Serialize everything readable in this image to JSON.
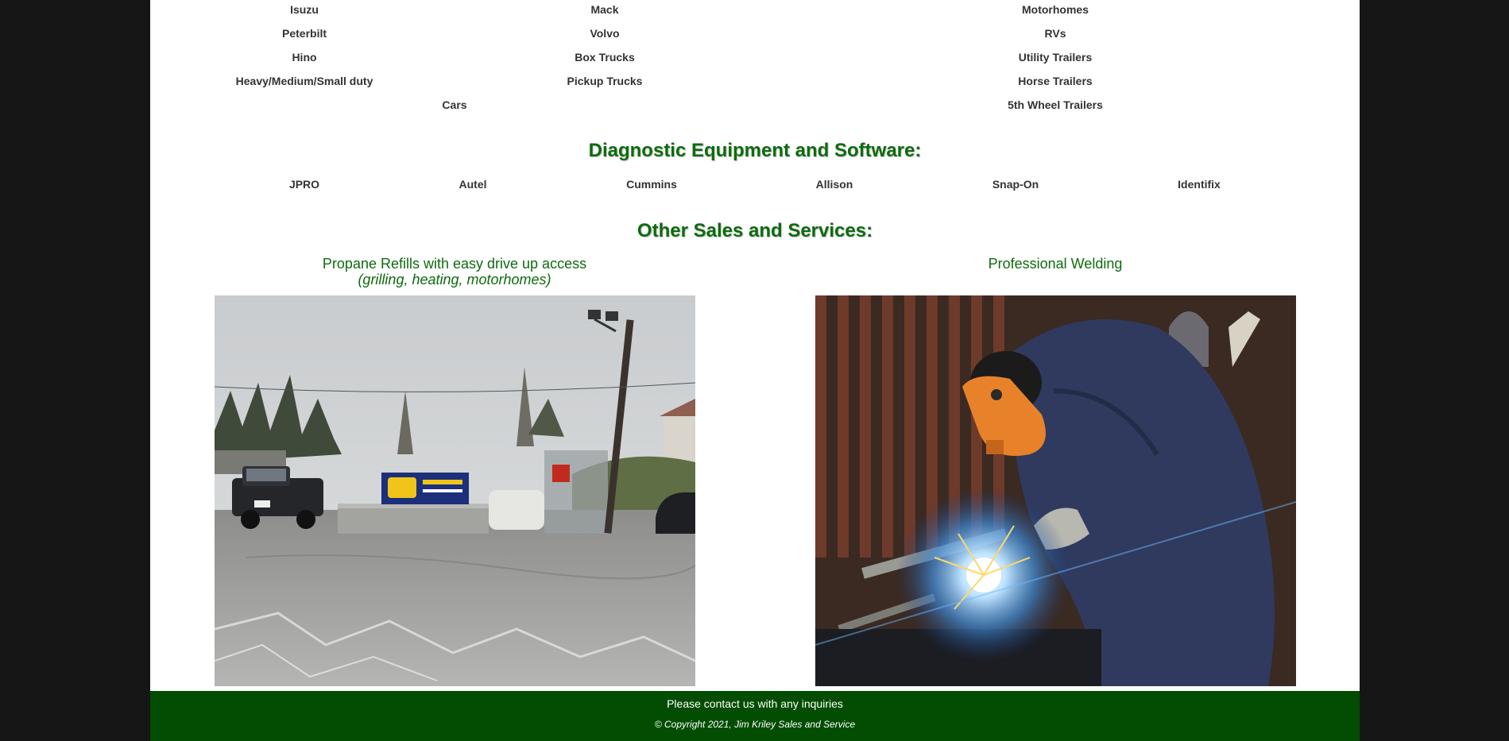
{
  "brands": {
    "row1": [
      "Isuzu",
      "Mack",
      "Motorhomes"
    ],
    "row2": [
      "Peterbilt",
      "Volvo",
      "RVs"
    ],
    "row3": [
      "Hino",
      "Box Trucks",
      "Utility Trailers"
    ],
    "row4": [
      "Heavy/Medium/Small duty",
      "Pickup Trucks",
      "Horse Trailers"
    ],
    "row5": [
      "Cars",
      "5th Wheel Trailers"
    ]
  },
  "diagnostic": {
    "title": "Diagnostic Equipment and Software:",
    "items": [
      "JPRO",
      "Autel",
      "Cummins",
      "Allison",
      "Snap-On",
      "Identifix"
    ]
  },
  "other_services": {
    "title": "Other Sales and Services:",
    "propane": {
      "caption": "Propane Refills with easy drive up access",
      "sub": "(grilling, heating, motorhomes)"
    },
    "welding": {
      "caption": "Professional Welding"
    }
  },
  "footer": {
    "contact": "Please contact us with any inquiries",
    "copyright": "© Copyright 2021, Jim Kriley Sales and Service"
  },
  "colors": {
    "accent_green": "#0e6b0e",
    "footer_bg": "#024d02",
    "outer_bg": "#161616"
  }
}
